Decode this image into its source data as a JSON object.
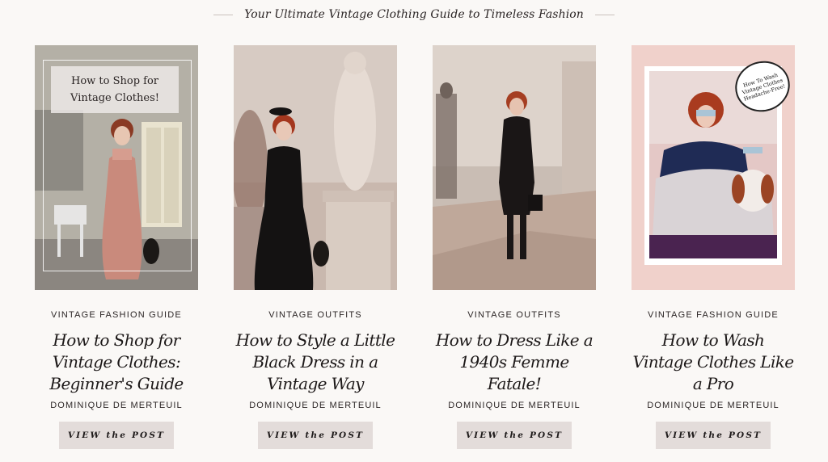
{
  "header": {
    "title": "Your Ultimate Vintage Clothing Guide to Timeless Fashion"
  },
  "cards": [
    {
      "category": "VINTAGE FASHION GUIDE",
      "title": "How to Shop for Vintage Clothes: Beginner's Guide",
      "author": "DOMINIQUE DE MERTEUIL",
      "button": "VIEW the POST",
      "overlay_line1": "How to Shop for",
      "overlay_line2": "Vintage Clothes!"
    },
    {
      "category": "VINTAGE OUTFITS",
      "title": "How to Style a Little Black Dress in a Vintage Way",
      "author": "DOMINIQUE DE MERTEUIL",
      "button": "VIEW the POST"
    },
    {
      "category": "VINTAGE OUTFITS",
      "title": "How to Dress Like a 1940s Femme Fatale!",
      "author": "DOMINIQUE DE MERTEUIL",
      "button": "VIEW the POST"
    },
    {
      "category": "VINTAGE FASHION GUIDE",
      "title": "How to Wash Vintage Clothes Like a Pro",
      "author": "DOMINIQUE DE MERTEUIL",
      "button": "VIEW the POST",
      "bubble_line1": "How To Wash",
      "bubble_line2": "Vintage Clothes",
      "bubble_line3": "Headache-Free!"
    }
  ],
  "colors": {
    "background": "#faf8f6",
    "button_bg": "#e3dcda",
    "card4_bg": "#f0d1cb"
  }
}
